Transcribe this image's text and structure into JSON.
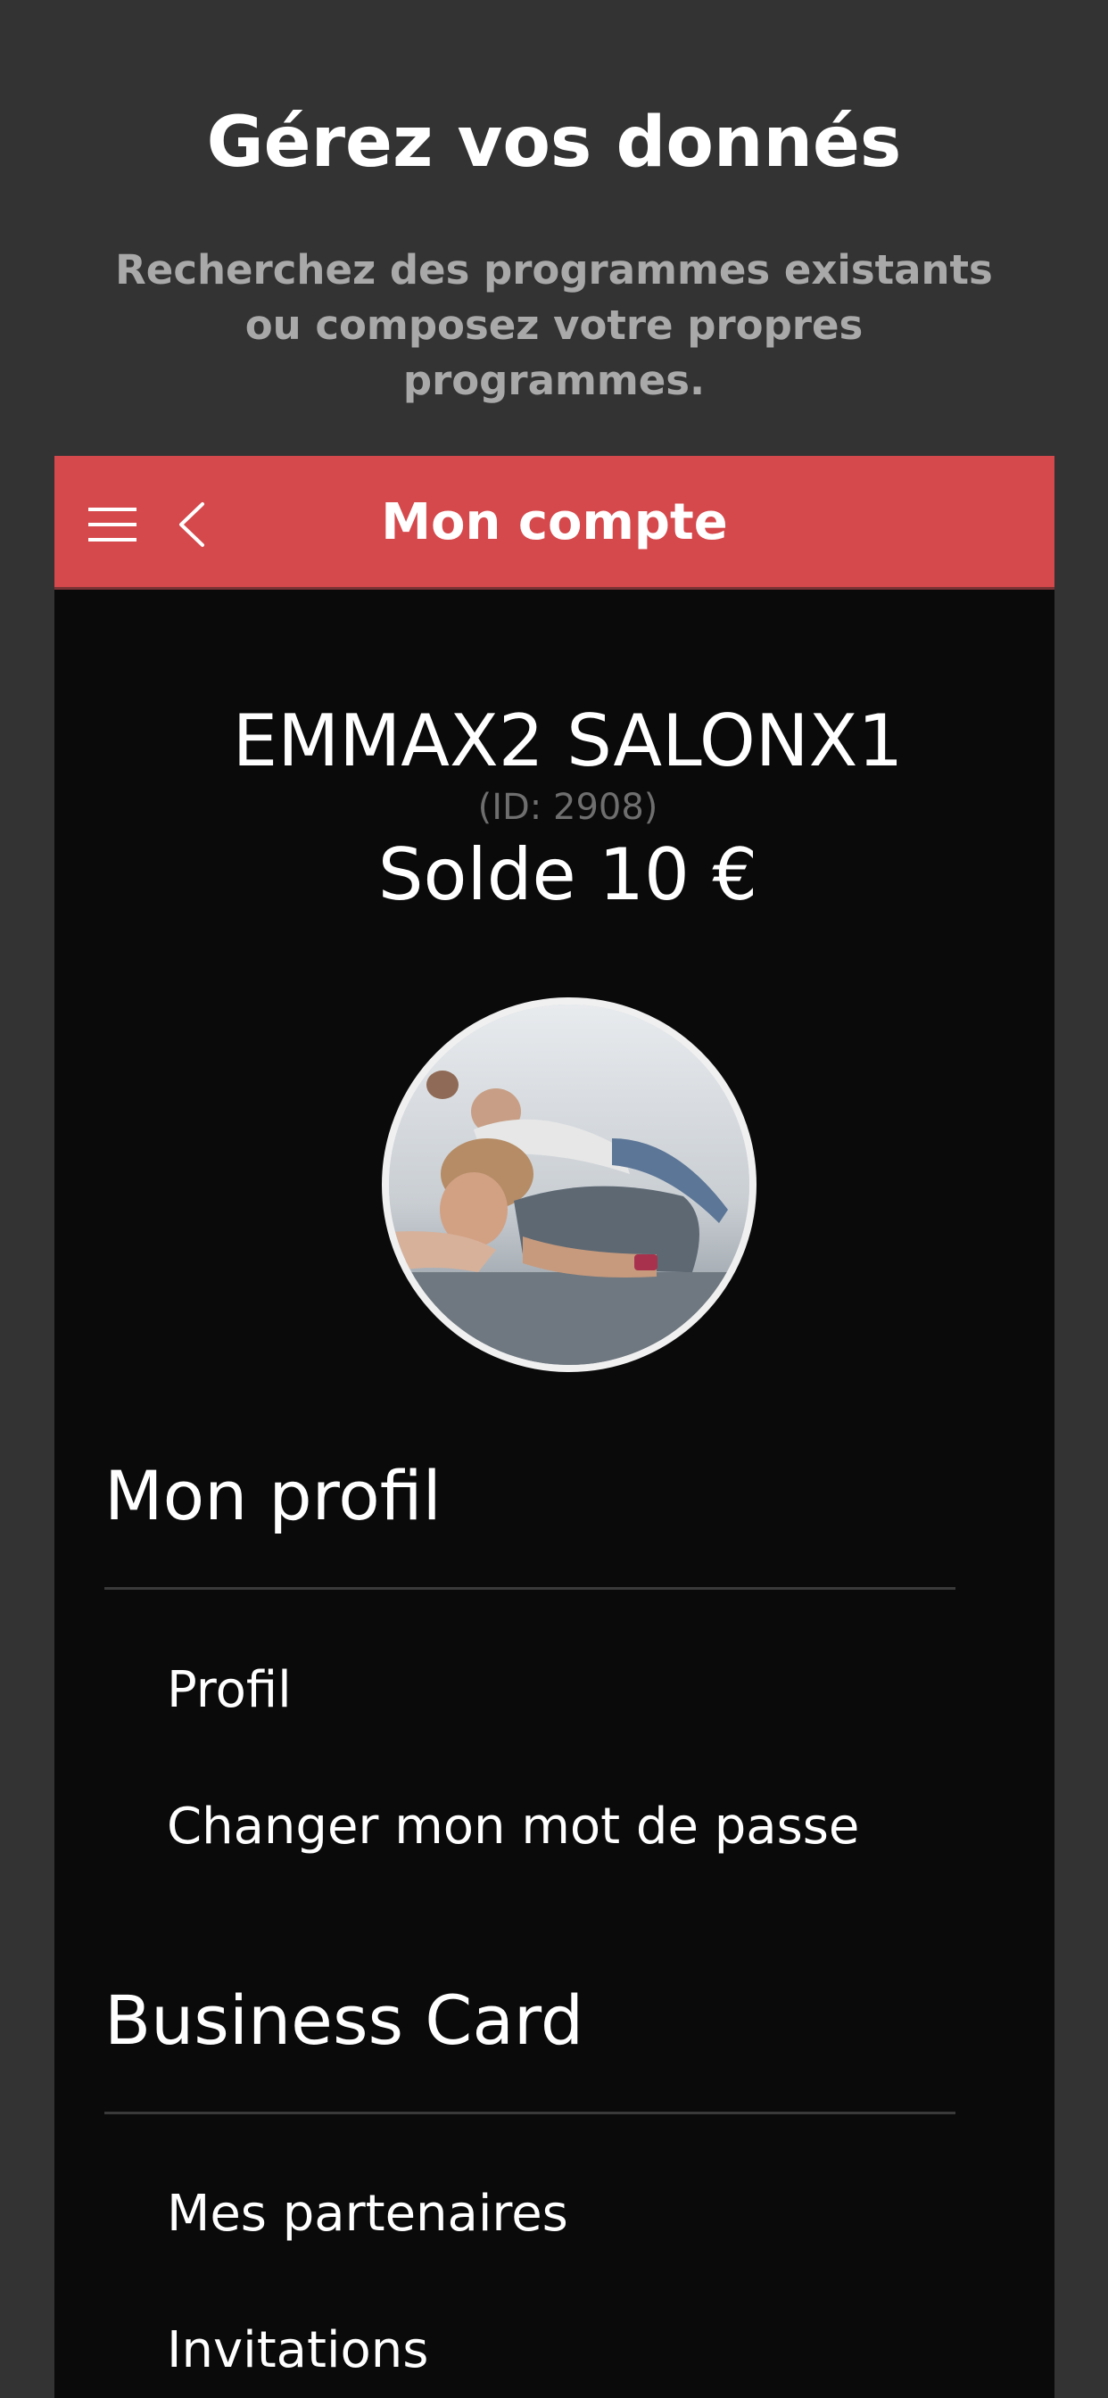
{
  "promo": {
    "title": "Gérez vos donnés",
    "subtitle": "Recherchez des programmes existants ou composez votre propres programmes."
  },
  "app_bar": {
    "title": "Mon compte",
    "background_color": "#d5484b",
    "menu_icon": "hamburger-menu-icon",
    "back_icon": "chevron-left-icon"
  },
  "account": {
    "name": "EMMAX2 SALONX1",
    "id_text": "(ID: 2908)",
    "balance": "Solde 10 €"
  },
  "sections": [
    {
      "title": "Mon profil",
      "items": [
        "Profil",
        "Changer mon mot de passe"
      ]
    },
    {
      "title": "Business Card",
      "items": [
        "Mes partenaires",
        "Invitations"
      ]
    }
  ]
}
